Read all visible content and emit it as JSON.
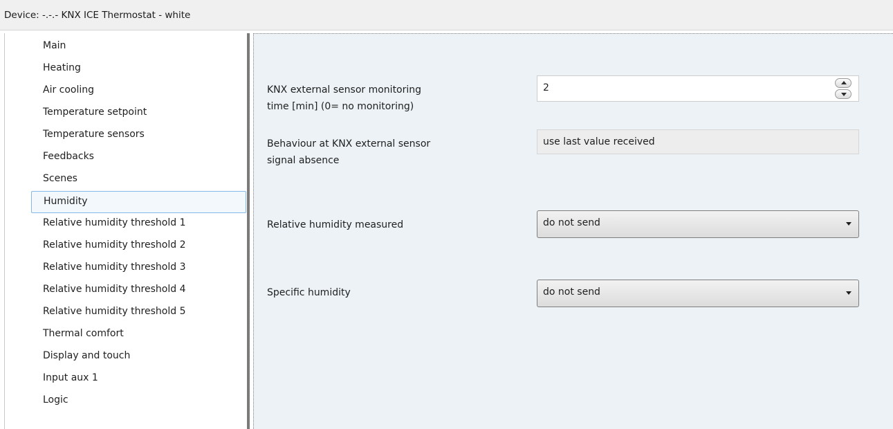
{
  "window": {
    "title": "Device: -.-.-  KNX ICE Thermostat - white"
  },
  "sidebar": {
    "items": [
      {
        "label": "Main"
      },
      {
        "label": "Heating"
      },
      {
        "label": "Air cooling"
      },
      {
        "label": "Temperature setpoint"
      },
      {
        "label": "Temperature sensors"
      },
      {
        "label": "Feedbacks"
      },
      {
        "label": "Scenes"
      },
      {
        "label": "Humidity",
        "selected": true
      },
      {
        "label": "Relative humidity threshold 1"
      },
      {
        "label": "Relative humidity threshold 2"
      },
      {
        "label": "Relative humidity threshold 3"
      },
      {
        "label": "Relative humidity threshold 4"
      },
      {
        "label": "Relative humidity threshold 5"
      },
      {
        "label": "Thermal comfort"
      },
      {
        "label": "Display and touch"
      },
      {
        "label": "Input aux 1"
      },
      {
        "label": "Logic"
      }
    ]
  },
  "params": {
    "monitoring_time": {
      "label_line1": "KNX external sensor monitoring",
      "label_line2": "time [min] (0= no monitoring)",
      "value": "2"
    },
    "behaviour": {
      "label_line1": "Behaviour at KNX external sensor",
      "label_line2": "signal absence",
      "value": "use last value received"
    },
    "rh_measured": {
      "label": "Relative humidity measured",
      "value": "do not send"
    },
    "specific_humidity": {
      "label": "Specific humidity",
      "value": "do not send"
    }
  }
}
